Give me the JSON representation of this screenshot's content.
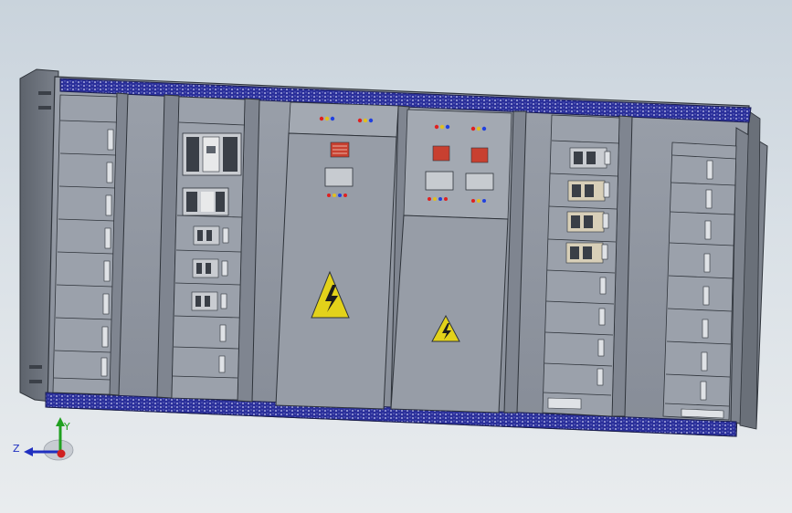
{
  "scene": {
    "colors": {
      "background_top": "#c9d3dc",
      "background_bottom": "#e9ecee",
      "cabinet_face": "#8c939e",
      "cabinet_face_light": "#a7adb6",
      "cabinet_dark": "#5d636c",
      "outline": "#2e333a",
      "rail_blue": "#2a2f9a",
      "rail_dots": "#c9ccf0",
      "warning_yellow": "#e3d21a",
      "lamp_red": "#e02020",
      "lamp_yellow": "#e0c020",
      "lamp_blue": "#2040e0",
      "meter_red": "#c84030"
    },
    "icons": [
      "high-voltage-warning-icon",
      "indicator-lamp-icon",
      "breaker-icon",
      "coordinate-triad-icon"
    ]
  },
  "axes": {
    "y_label": "Y",
    "z_label": "Z",
    "y_color": "#20a020",
    "z_color": "#2030c0",
    "x_color": "#d02020"
  }
}
